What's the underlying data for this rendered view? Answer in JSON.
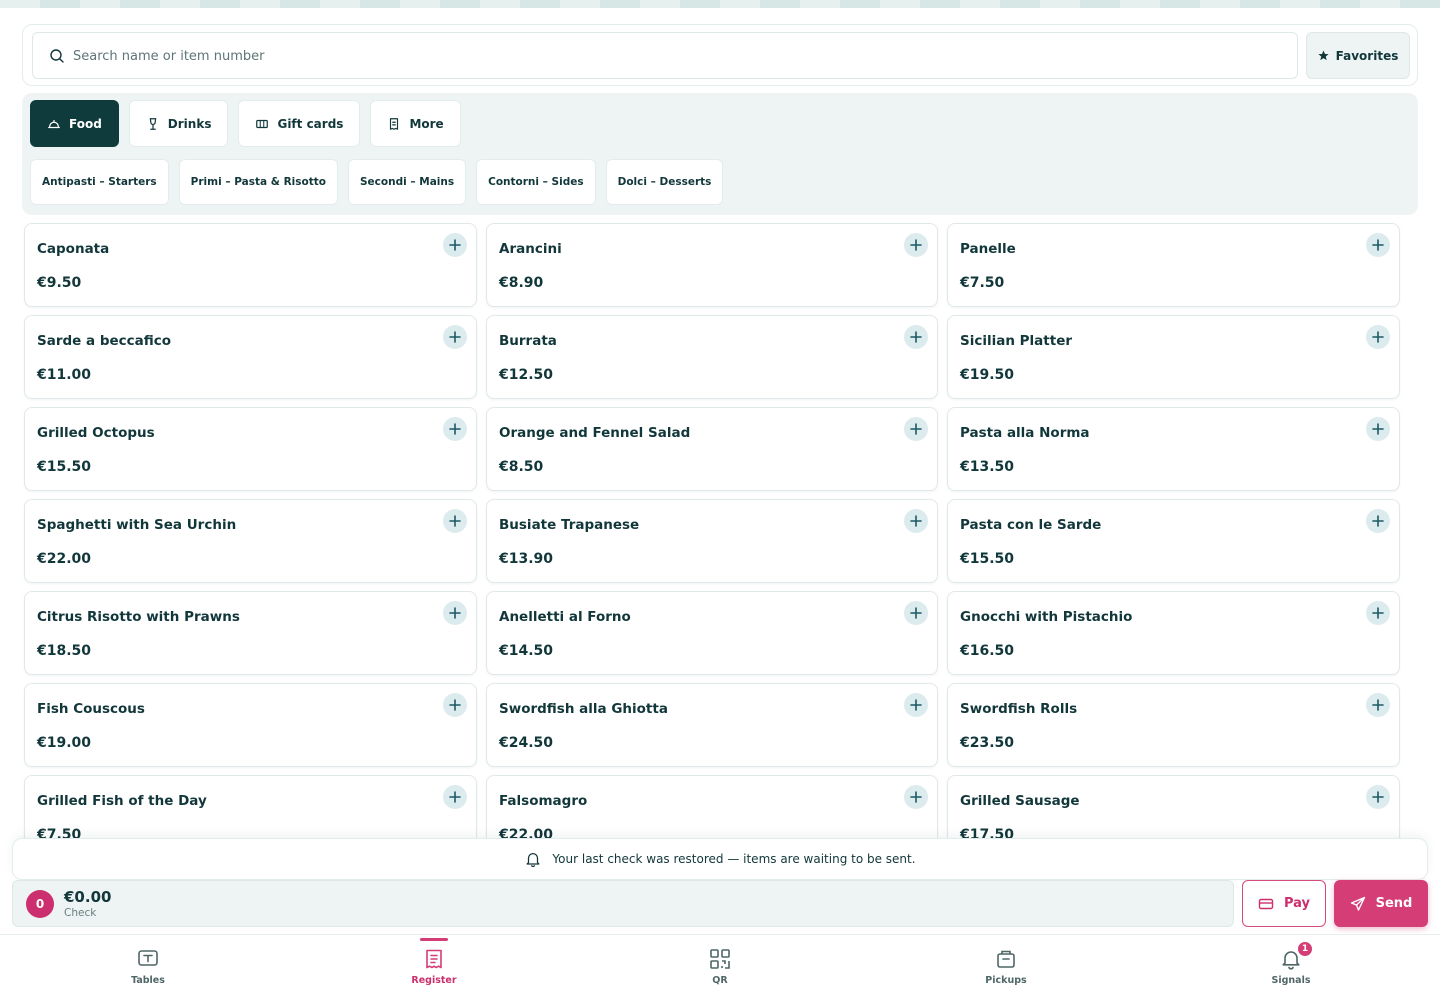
{
  "search": {
    "placeholder": "Search name or item number",
    "value": "",
    "favorites_label": "Favorites"
  },
  "categories": {
    "main": [
      {
        "label": "Food",
        "icon": "cloche-icon",
        "active": true
      },
      {
        "label": "Drinks",
        "icon": "wine-glass-icon",
        "active": false
      },
      {
        "label": "Gift cards",
        "icon": "gift-card-icon",
        "active": false
      },
      {
        "label": "More",
        "icon": "receipt-icon",
        "active": false
      }
    ],
    "sub": [
      {
        "label": "Antipasti – Starters"
      },
      {
        "label": "Primi – Pasta & Risotto"
      },
      {
        "label": "Secondi – Mains"
      },
      {
        "label": "Contorni – Sides"
      },
      {
        "label": "Dolci – Desserts"
      }
    ]
  },
  "menu_items": [
    {
      "name": "Caponata",
      "price": "€9.50"
    },
    {
      "name": "Arancini",
      "price": "€8.90"
    },
    {
      "name": "Panelle",
      "price": "€7.50"
    },
    {
      "name": "Sarde a beccafico",
      "price": "€11.00"
    },
    {
      "name": "Burrata",
      "price": "€12.50"
    },
    {
      "name": "Sicilian Platter",
      "price": "€19.50"
    },
    {
      "name": "Grilled Octopus",
      "price": "€15.50"
    },
    {
      "name": "Orange and Fennel Salad",
      "price": "€8.50"
    },
    {
      "name": "Pasta alla Norma",
      "price": "€13.50"
    },
    {
      "name": "Spaghetti with Sea Urchin",
      "price": "€22.00"
    },
    {
      "name": "Busiate Trapanese",
      "price": "€13.90"
    },
    {
      "name": "Pasta con le Sarde",
      "price": "€15.50"
    },
    {
      "name": "Citrus Risotto with Prawns",
      "price": "€18.50"
    },
    {
      "name": "Anelletti al Forno",
      "price": "€14.50"
    },
    {
      "name": "Gnocchi with Pistachio",
      "price": "€16.50"
    },
    {
      "name": "Fish Couscous",
      "price": "€19.00"
    },
    {
      "name": "Swordfish alla Ghiotta",
      "price": "€24.50"
    },
    {
      "name": "Swordfish Rolls",
      "price": "€23.50"
    },
    {
      "name": "Grilled Fish of the Day",
      "price": "€7.50"
    },
    {
      "name": "Falsomagro",
      "price": "€22.00"
    },
    {
      "name": "Grilled Sausage",
      "price": "€17.50"
    }
  ],
  "notice": {
    "text": "Your last check was restored — items are waiting to be sent.",
    "icon": "bell-icon"
  },
  "check": {
    "item_count": "0",
    "total": "€0.00",
    "label": "Check",
    "pay_label": "Pay",
    "send_label": "Send"
  },
  "bottom_nav": [
    {
      "label": "Tables",
      "icon": "table-icon",
      "active": false
    },
    {
      "label": "Register",
      "icon": "register-icon",
      "active": true
    },
    {
      "label": "QR",
      "icon": "qr-icon",
      "active": false
    },
    {
      "label": "Pickups",
      "icon": "pickup-box-icon",
      "active": false
    },
    {
      "label": "Signals",
      "icon": "bell-icon",
      "active": false,
      "badge": "1"
    }
  ],
  "colors": {
    "primary_dark": "#0f3b3d",
    "accent_pink": "#d43d76",
    "panel_bg": "#eef3f3",
    "add_button_bg": "#dcebee"
  }
}
